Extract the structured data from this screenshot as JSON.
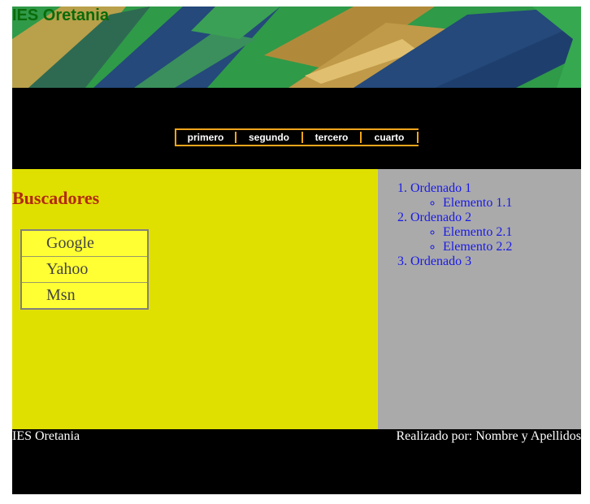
{
  "header": {
    "title": "IES Oretania"
  },
  "nav": {
    "items": [
      "primero",
      "segundo",
      "tercero",
      "cuarto"
    ]
  },
  "main": {
    "title": "Buscadores",
    "search_engines": [
      "Google",
      "Yahoo",
      "Msn"
    ]
  },
  "sidebar": {
    "list": [
      {
        "label": "Ordenado 1",
        "children": [
          "Elemento 1.1"
        ]
      },
      {
        "label": "Ordenado 2",
        "children": [
          "Elemento 2.1",
          "Elemento 2.2"
        ]
      },
      {
        "label": "Ordenado 3",
        "children": []
      }
    ]
  },
  "footer": {
    "left": "IES Oretania",
    "right": "Realizado por: Nombre y Apellidos"
  },
  "colors": {
    "header_title": "#0a6b0a",
    "nav_background": "#000000",
    "nav_border": "#f2a51c",
    "main_background": "#e0e000",
    "section_title": "#b22a10",
    "search_item_background": "#ffff33",
    "sidebar_background": "#aaaaaa",
    "list_link": "#1a1ae6",
    "footer_background": "#000000"
  }
}
